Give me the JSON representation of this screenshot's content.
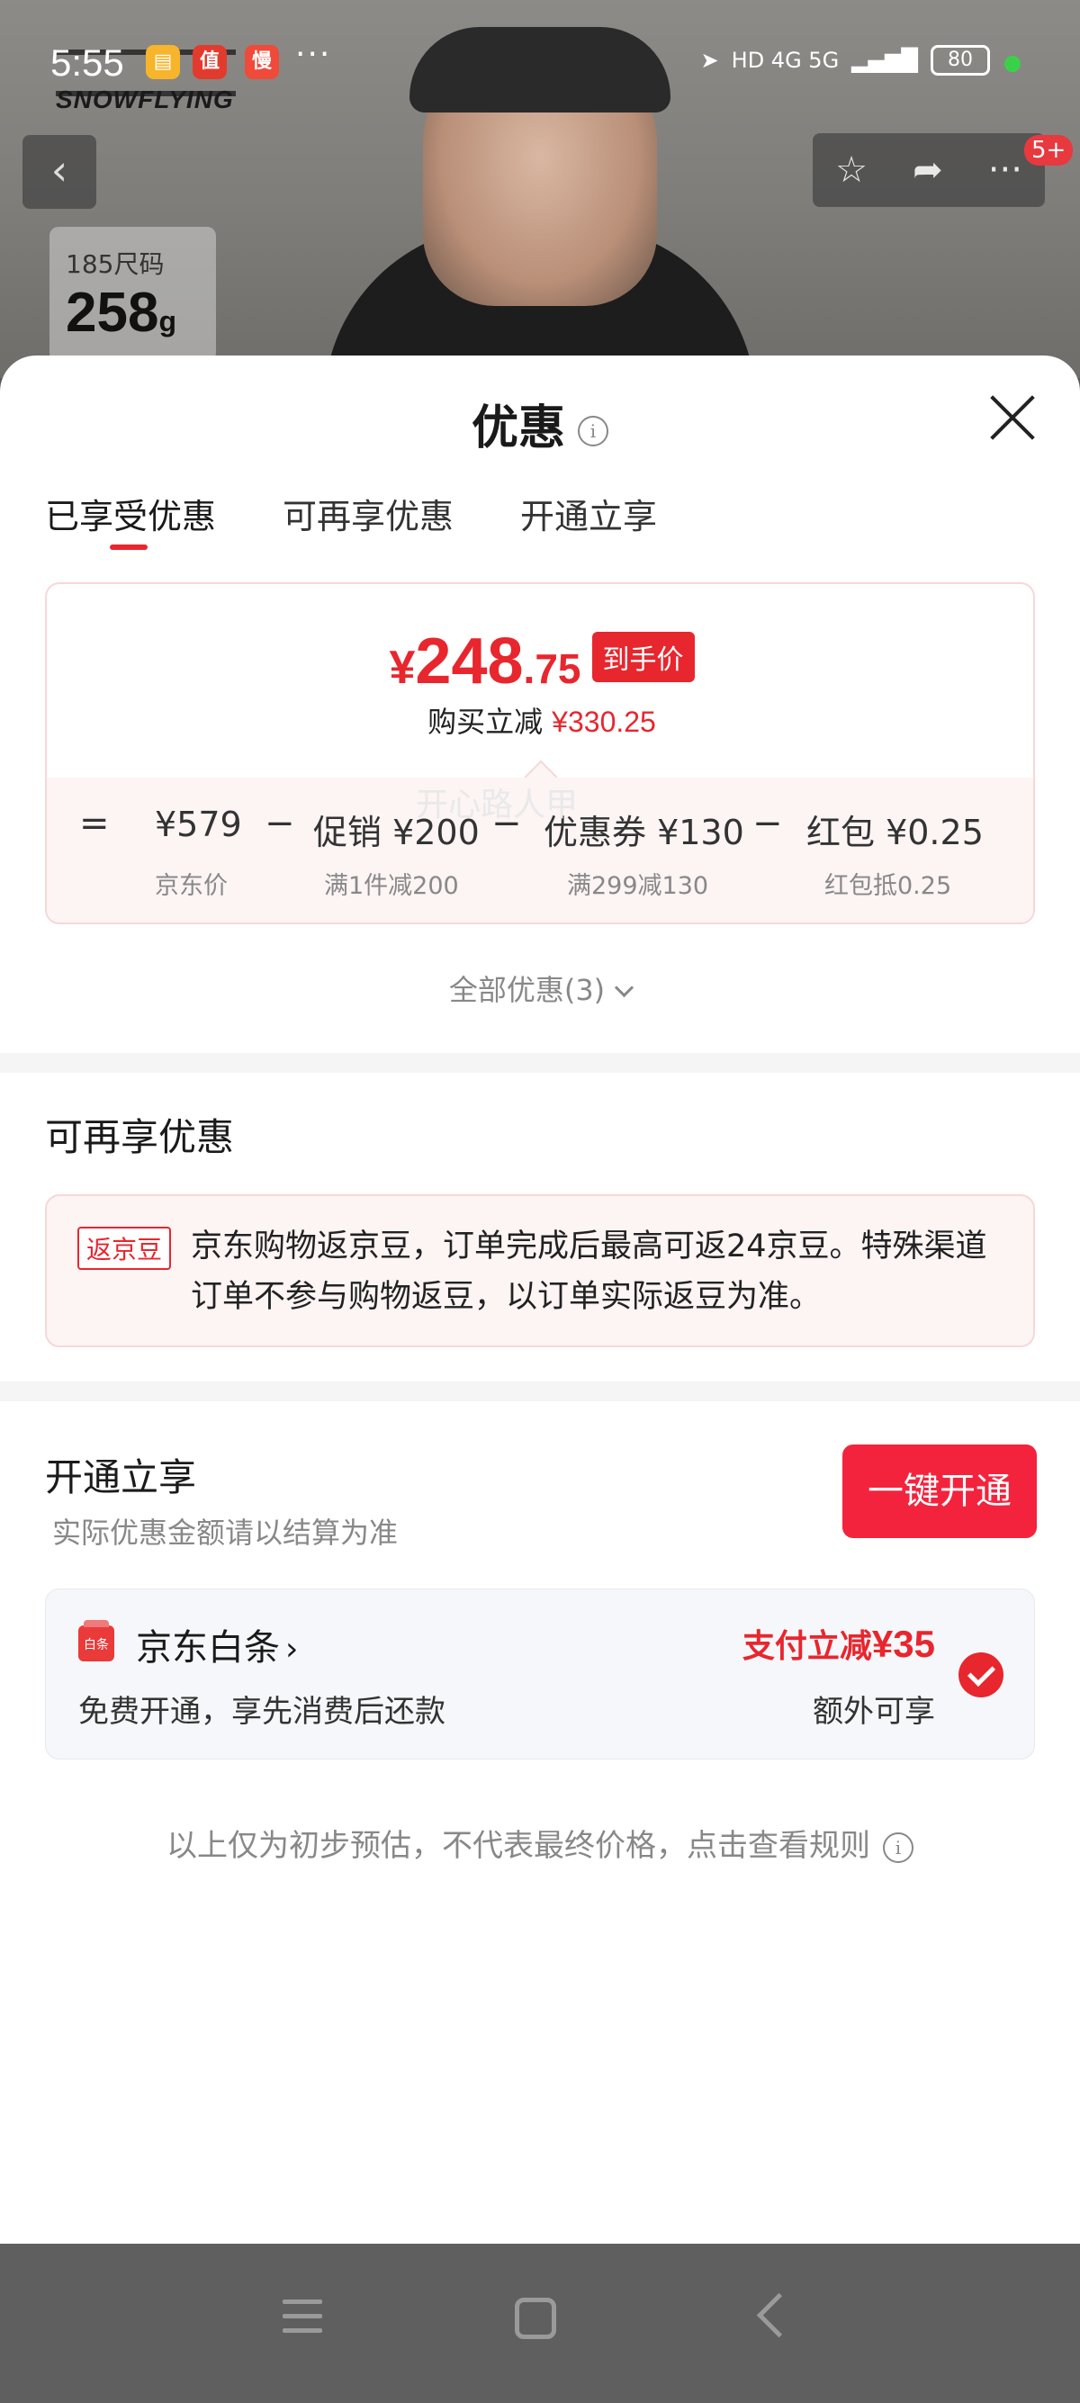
{
  "status_bar": {
    "time": "5:55",
    "app_icons": [
      "note-app-icon",
      "zhide-app-icon",
      "man-app-icon"
    ],
    "more": "···",
    "network": "HD 4G 5G",
    "battery": "80"
  },
  "product": {
    "brand": "SNOWFLYING",
    "size_label": "185尺码",
    "weight_value": "258",
    "weight_unit": "g",
    "notification_badge": "5+"
  },
  "sheet": {
    "title": "优惠",
    "tabs": [
      {
        "label": "已享受优惠"
      },
      {
        "label": "可再享优惠"
      },
      {
        "label": "开通立享"
      }
    ],
    "price": {
      "currency": "¥",
      "integer": "248",
      "decimal": ".75",
      "tag": "到手价",
      "subtitle_label": "购买立减",
      "subtitle_amount": "¥330.25"
    },
    "breakdown": {
      "equals": "=",
      "minus": "−",
      "items": [
        {
          "label": "¥579",
          "sub": "京东价"
        },
        {
          "label": "促销 ¥200",
          "sub": "满1件减200"
        },
        {
          "label": "优惠券 ¥130",
          "sub": "满299减130"
        },
        {
          "label": "红包 ¥0.25",
          "sub": "红包抵0.25"
        }
      ]
    },
    "all_discounts": "全部优惠(3)",
    "reshare": {
      "title": "可再享优惠",
      "watermark": "开心路人甲",
      "tag": "返京豆",
      "text": "京东购物返京豆，订单完成后最高可返24京豆。特殊渠道订单不参与购物返豆，以订单实际返豆为准。"
    },
    "activate": {
      "title": "开通立享",
      "note": "实际优惠金额请以结算为准",
      "button": "一键开通",
      "baitiao": {
        "logo_text": "白条",
        "name": "京东白条",
        "arrow": "›",
        "desc": "免费开通，享先消费后还款",
        "promo_label": "支付立减",
        "promo_amount": "¥35",
        "extra": "额外可享"
      }
    },
    "footer_note": "以上仅为初步预估，不代表最终价格，点击查看规则"
  },
  "colors": {
    "accent_red": "#e8262e",
    "button_red": "#f4233d",
    "box_pink_bg": "#fdf4f4"
  }
}
